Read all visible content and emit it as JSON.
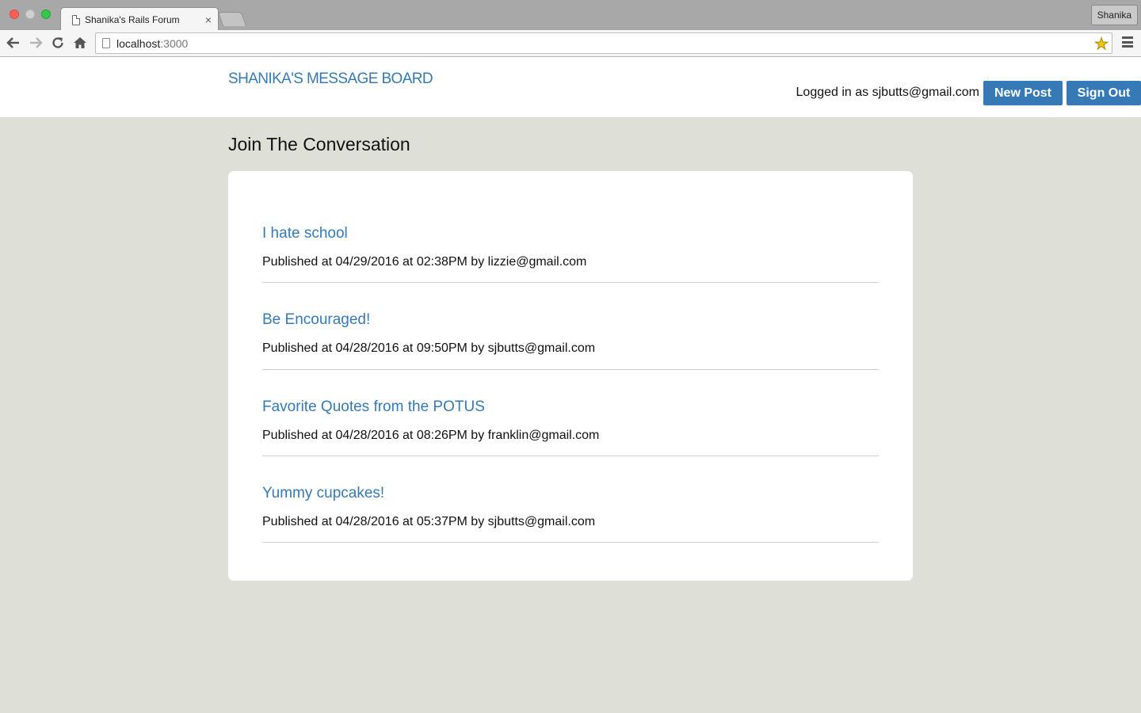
{
  "browser": {
    "tab_title": "Shanika's Rails Forum",
    "tab_close": "×",
    "profile_name": "Shanika",
    "url_host": "localhost",
    "url_port": ":3000"
  },
  "header": {
    "brand": "SHANIKA'S MESSAGE BOARD",
    "logged_in_text": "Logged in as sjbutts@gmail.com",
    "new_post_label": "New Post",
    "sign_out_label": "Sign Out"
  },
  "main": {
    "heading": "Join The Conversation",
    "posts": [
      {
        "title": "I hate school",
        "meta": "Published at 04/29/2016 at 02:38PM by lizzie@gmail.com"
      },
      {
        "title": "Be Encouraged!",
        "meta": "Published at 04/28/2016 at 09:50PM by sjbutts@gmail.com"
      },
      {
        "title": "Favorite Quotes from the POTUS",
        "meta": "Published at 04/28/2016 at 08:26PM by franklin@gmail.com"
      },
      {
        "title": "Yummy cupcakes!",
        "meta": "Published at 04/28/2016 at 05:37PM by sjbutts@gmail.com"
      }
    ]
  },
  "colors": {
    "accent": "#357ab7",
    "page_background": "#dedfd7"
  }
}
